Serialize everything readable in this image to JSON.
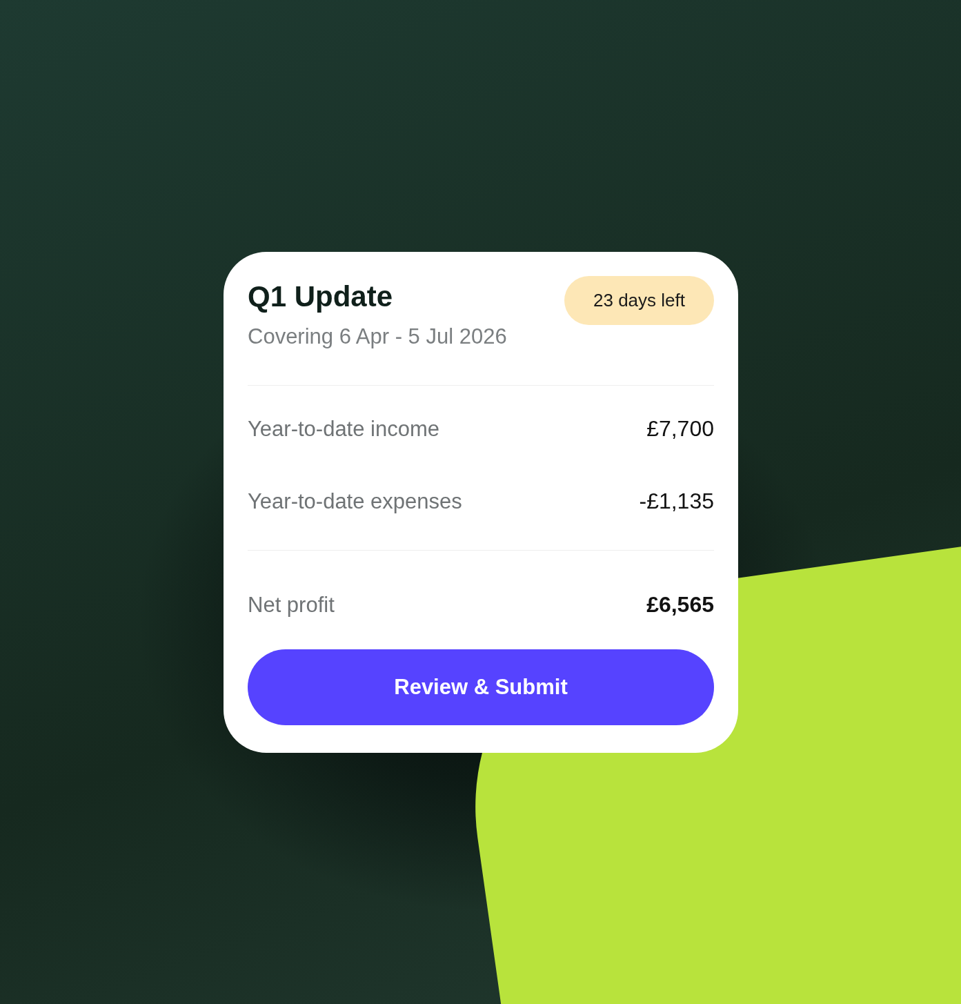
{
  "card": {
    "title": "Q1 Update",
    "subtitle": "Covering 6 Apr - 5 Jul 2026",
    "badge": "23 days left",
    "rows": [
      {
        "label": "Year-to-date income",
        "value": "£7,700"
      },
      {
        "label": "Year-to-date expenses",
        "value": "-£1,135"
      }
    ],
    "total": {
      "label": "Net profit",
      "value": "£6,565"
    },
    "button": "Review & Submit"
  }
}
